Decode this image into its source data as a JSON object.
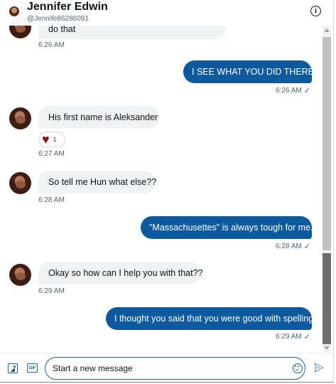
{
  "header": {
    "name": "Jennifer Edwin",
    "handle": "@Jennife86286091",
    "info_icon": "i"
  },
  "messages": [
    {
      "direction": "in",
      "text": "do that",
      "time": "6:26 AM"
    },
    {
      "direction": "out",
      "text": "I SEE WHAT YOU DID THERE.",
      "time": "6:26 AM",
      "status": "seen"
    },
    {
      "direction": "in",
      "text": "His first name is Aleksander",
      "time": "6:27 AM",
      "reaction": {
        "icon": "heart-icon",
        "count": "1"
      }
    },
    {
      "direction": "in",
      "text": "So tell me Hun what else??",
      "time": "6:28 AM"
    },
    {
      "direction": "out",
      "text": "\"Massachusettes\" is always tough for me.",
      "time": "6:28 AM",
      "status": "seen"
    },
    {
      "direction": "in",
      "text": "Okay so how can I help you with that??",
      "time": "6:29 AM"
    },
    {
      "direction": "out",
      "text": "I thought you said that you were good with spelling!",
      "time": "6:29 AM",
      "status": "seen"
    }
  ],
  "check_glyph": "✓",
  "composer": {
    "placeholder": "Start a new message",
    "value": "",
    "gif_label": "GIF",
    "icons": [
      "media-icon",
      "gif-icon",
      "emoji-icon",
      "send-icon"
    ]
  },
  "colors": {
    "outgoing_bubble": "#0d5a9e",
    "incoming_bubble": "#eff3f4",
    "accent": "#1d5f9a",
    "heart": "#8a1414"
  }
}
